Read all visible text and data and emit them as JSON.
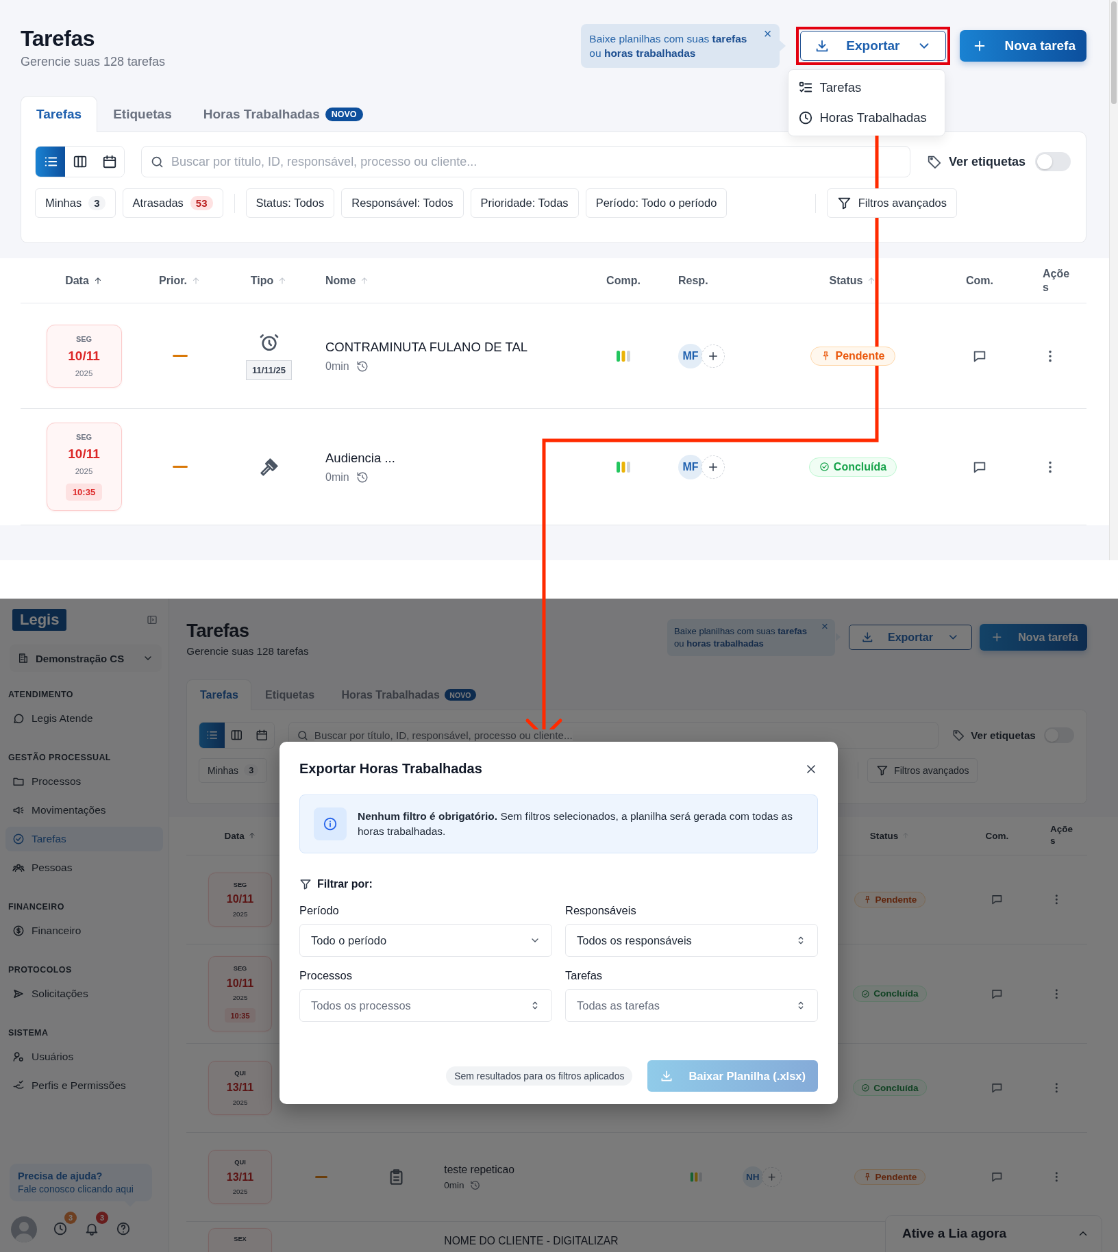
{
  "top_screen": {
    "header": {
      "title": "Tarefas",
      "subtitle": "Gerencie suas 128 tarefas"
    },
    "tooltip": {
      "text": "Baixe planilhas com suas **tarefas** ou **horas trabalhadas**",
      "close": "×"
    },
    "export": {
      "label": "Exportar",
      "highlighted": true,
      "menu": [
        {
          "label": "Tarefas",
          "kind": "list"
        },
        {
          "label": "Horas Trabalhadas",
          "kind": "clock"
        }
      ]
    },
    "new_task": {
      "label": "Nova tarefa"
    },
    "tabs": [
      {
        "label": "Tarefas",
        "selected": true
      },
      {
        "label": "Etiquetas",
        "selected": false
      },
      {
        "label": "Horas Trabalhadas",
        "selected": false,
        "badge": "NOVO"
      }
    ],
    "views": [
      {
        "kind": "list",
        "selected": true
      },
      {
        "kind": "columns",
        "selected": false
      },
      {
        "kind": "calendar",
        "selected": false
      }
    ],
    "search": {
      "placeholder": "Buscar por título, ID, responsável, processo ou cliente..."
    },
    "tags_toggle": {
      "label": "Ver etiquetas",
      "on": false
    },
    "quick_filters": [
      {
        "label": "Minhas",
        "count": "3",
        "kind": "neutral"
      },
      {
        "label": "Atrasadas",
        "count": "53",
        "kind": "alert"
      }
    ],
    "filters": [
      {
        "label": "Status: Todos"
      },
      {
        "label": "Responsável: Todos"
      },
      {
        "label": "Prioridade: Todas"
      },
      {
        "label": "Período: Todo o período"
      }
    ],
    "advanced_filter": {
      "label": "Filtros avançados"
    },
    "table": {
      "columns": {
        "date": {
          "label": "Data",
          "sortable": true,
          "sorted": true
        },
        "priority": {
          "label": "Prior.",
          "sortable": true,
          "sorted": false
        },
        "type": {
          "label": "Tipo",
          "sortable": true,
          "sorted": false
        },
        "name": {
          "label": "Nome",
          "sortable": true,
          "sorted": false
        },
        "comp": {
          "label": "Comp."
        },
        "resp": {
          "label": "Resp."
        },
        "status": {
          "label": "Status",
          "sortable": true,
          "sorted": false
        },
        "comments": {
          "label": "Com."
        },
        "actions": {
          "label": "Ações"
        }
      },
      "rows": [
        {
          "kind": "alarm",
          "date": {
            "weekday": "SEG",
            "day": "10/11",
            "year": "2025"
          },
          "priority_mark": true,
          "due": "11/11/25",
          "name": "CONTRAMINUTA FULANO DE TAL",
          "duration": "0min",
          "completion": true,
          "assignee": "MF",
          "add_assignee": true,
          "status": {
            "label": "Pendente",
            "kind": "pending"
          },
          "comments": true,
          "menu": true
        },
        {
          "kind": "gavel",
          "date": {
            "weekday": "SEG",
            "day": "10/11",
            "year": "2025",
            "time": "10:35"
          },
          "priority_mark": true,
          "name": "Audiencia ...",
          "duration": "0min",
          "completion": true,
          "assignee": "MF",
          "add_assignee": true,
          "status": {
            "label": "Concluída",
            "kind": "done"
          },
          "comments": true,
          "menu": true
        }
      ]
    }
  },
  "bottom_screen": {
    "sidebar": {
      "logo": "Legis",
      "workspace": "Demonstração CS",
      "sections": [
        {
          "title": "ATENDIMENTO",
          "items": [
            {
              "label": "Legis Atende",
              "kind": "chat",
              "selected": false
            }
          ]
        },
        {
          "title": "GESTÃO PROCESSUAL",
          "items": [
            {
              "label": "Processos",
              "kind": "folder",
              "selected": false
            },
            {
              "label": "Movimentações",
              "kind": "megaphone",
              "selected": false
            },
            {
              "label": "Tarefas",
              "kind": "check",
              "selected": true
            },
            {
              "label": "Pessoas",
              "kind": "people",
              "selected": false
            }
          ]
        },
        {
          "title": "FINANCEIRO",
          "items": [
            {
              "label": "Financeiro",
              "kind": "money",
              "selected": false
            }
          ]
        },
        {
          "title": "PROTOCOLOS",
          "items": [
            {
              "label": "Solicitações",
              "kind": "send",
              "selected": false
            }
          ]
        },
        {
          "title": "SISTEMA",
          "items": [
            {
              "label": "Usuários",
              "kind": "usergear",
              "selected": false
            },
            {
              "label": "Perfis e Permissões",
              "kind": "hand",
              "selected": false
            }
          ]
        }
      ],
      "help": {
        "title": "Precisa de ajuda?",
        "text": "Fale conosco clicando aqui"
      },
      "footer": [
        {
          "kind": "avatar"
        },
        {
          "kind": "clock",
          "badge": "3"
        },
        {
          "kind": "bell",
          "badge": "3"
        },
        {
          "kind": "help"
        }
      ]
    },
    "main": {
      "header": {
        "title": "Tarefas",
        "subtitle": "Gerencie suas 128 tarefas"
      },
      "tooltip": {
        "text": "Baixe planilhas com suas **tarefas** ou **horas trabalhadas**",
        "close": "×"
      },
      "export": {
        "label": "Exportar",
        "highlighted": false
      },
      "new_task": {
        "label": "Nova tarefa"
      },
      "tabs": [
        {
          "label": "Tarefas",
          "selected": true
        },
        {
          "label": "Etiquetas",
          "selected": false
        },
        {
          "label": "Horas Trabalhadas",
          "selected": false,
          "badge": "NOVO"
        }
      ],
      "views": [
        {
          "kind": "list",
          "selected": true
        },
        {
          "kind": "columns",
          "selected": false
        },
        {
          "kind": "calendar",
          "selected": false
        }
      ],
      "search": {
        "placeholder": "Buscar por título, ID, responsável, processo ou cliente..."
      },
      "tags_toggle": {
        "label": "Ver etiquetas",
        "on": false
      },
      "quick_filters": [
        {
          "label": "Minhas",
          "count": "3",
          "kind": "neutral"
        }
      ],
      "advanced_filter": {
        "label": "Filtros avançados"
      },
      "table": {
        "columns": {
          "date": {
            "label": "Data",
            "sortable": true,
            "sorted": true
          },
          "status": {
            "label": "Status",
            "sortable": true,
            "sorted": false
          },
          "comments": {
            "label": "Com."
          },
          "actions": {
            "label": "Ações"
          }
        },
        "rows": [
          {
            "date": {
              "weekday": "SEG",
              "day": "10/11",
              "year": "2025"
            },
            "status": {
              "label": "Pendente",
              "kind": "pending"
            },
            "comments": true,
            "menu": true
          },
          {
            "date": {
              "weekday": "SEG",
              "day": "10/11",
              "year": "2025",
              "time": "10:35"
            },
            "status": {
              "label": "Concluída",
              "kind": "done"
            },
            "comments": true,
            "menu": true
          },
          {
            "date": {
              "weekday": "QUI",
              "day": "13/11",
              "year": "2025"
            },
            "status": {
              "label": "Concluída",
              "kind": "done"
            },
            "comments": true,
            "menu": true
          },
          {
            "kind": "clipboard",
            "date": {
              "weekday": "QUI",
              "day": "13/11",
              "year": "2025"
            },
            "priority_mark": true,
            "name": "teste repeticao",
            "duration": "0min",
            "completion": true,
            "assignee": "NH",
            "add_assignee": true,
            "status": {
              "label": "Pendente",
              "kind": "pending"
            },
            "comments": true,
            "menu": true
          },
          {
            "clipped": true,
            "date": {
              "weekday": "SEX"
            },
            "name": "NOME DO CLIENTE - DIGITALIZAR"
          }
        ]
      }
    },
    "lia_widget": {
      "label": "Ative a Lia agora"
    },
    "modal": {
      "title": "Exportar Horas Trabalhadas",
      "notice": "**Nenhum filtro é obrigatório.** Sem filtros selecionados, a planilha será gerada com todas as horas trabalhadas.",
      "filter_heading": "Filtrar por:",
      "fields": [
        {
          "label": "Período",
          "value": "Todo o período",
          "kind": "dropdown"
        },
        {
          "label": "Responsáveis",
          "value": "Todos os responsáveis",
          "kind": "combobox"
        },
        {
          "label": "Processos",
          "placeholder": "Todos os processos",
          "kind": "combobox"
        },
        {
          "label": "Tarefas",
          "placeholder": "Todas as tarefas",
          "kind": "combobox"
        }
      ],
      "result_note": "Sem resultados para os filtros aplicados",
      "download": {
        "label": "Baixar Planilha (.xlsx)",
        "disabled": true
      }
    }
  }
}
